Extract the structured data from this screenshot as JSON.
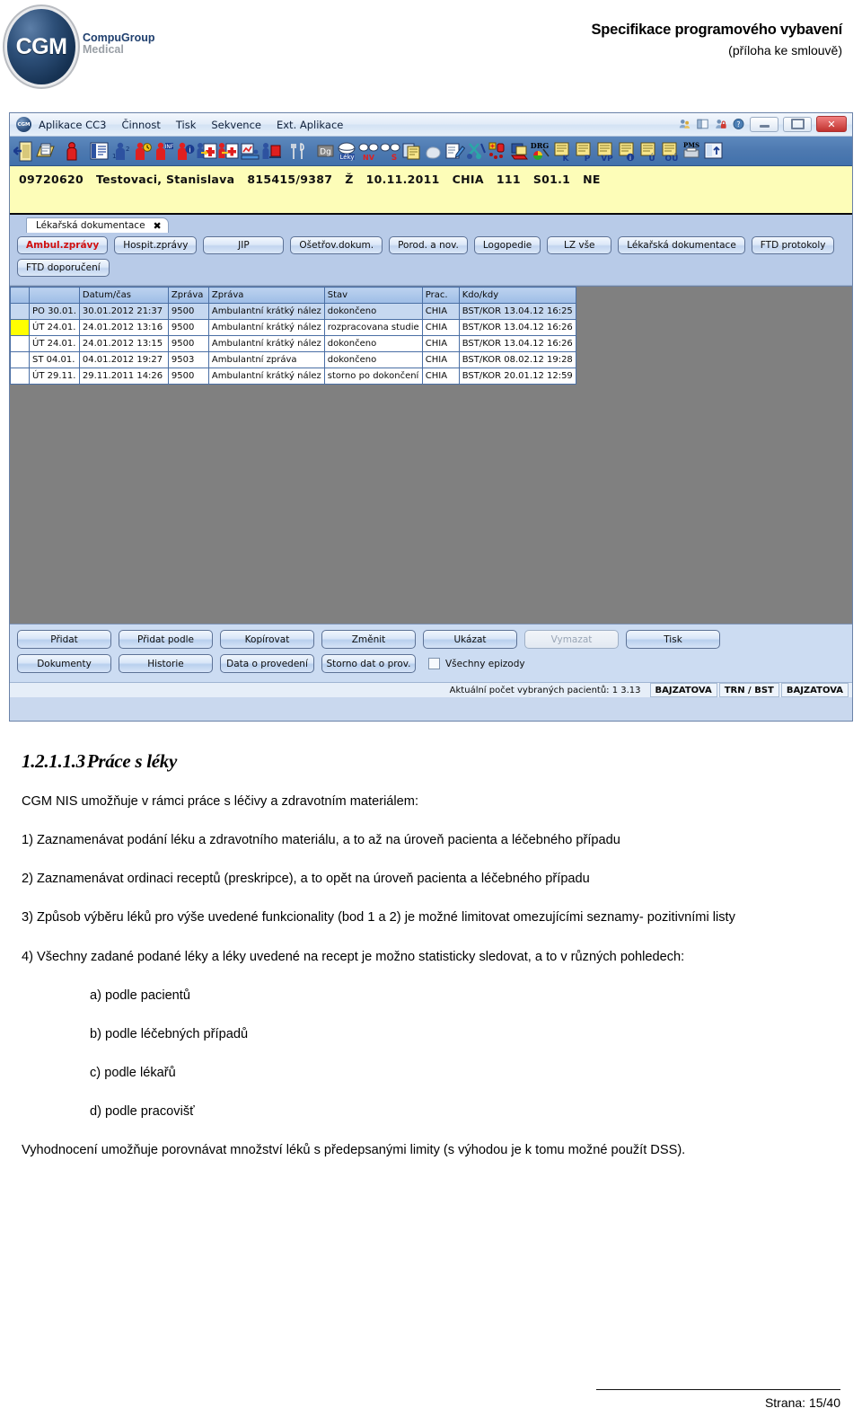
{
  "page_header": {
    "logo_mark": "CGM",
    "logo_line1": "CompuGroup",
    "logo_line2": "Medical",
    "title": "Specifikace programového vybavení",
    "subtitle": "(příloha ke smlouvě)"
  },
  "app": {
    "menu": {
      "badge": "CGM",
      "items": [
        "Aplikace CC3",
        "Činnost",
        "Tisk",
        "Sekvence",
        "Ext. Aplikace"
      ]
    },
    "window_controls": {
      "minimize": "–",
      "restore": "❐",
      "close": "✕"
    },
    "toolbar_icons": [
      "exit-door-icon",
      "folder-pages-icon",
      "patient-icon",
      "patient-list-icon",
      "patient-numbers-icon",
      "patient-clock-icon",
      "patient-inf-icon",
      "patient-info-icon",
      "patient-card-add-icon",
      "patient-card-transfer-icon",
      "patient-chart-icon",
      "patient-bed-icon",
      "patient-group-icon",
      "cutlery-icon",
      "dg-icon",
      "leky-pill-icon",
      "nv-glasses-icon",
      "glasses-s-icon",
      "calendar-notes-icon",
      "hand-icon",
      "prescription-pen-icon",
      "scissors-icon",
      "pills-scatter-icon",
      "folder-red-icon",
      "drg-icon",
      "report-k-icon",
      "report-p-icon",
      "report-vp-icon",
      "report-i-icon",
      "report-u-icon",
      "report-ou-icon",
      "pms-printer-icon",
      "export-icon"
    ],
    "patient_bar": [
      "09720620",
      "Testovaci, Stanislava",
      "815415/9387",
      "Ž",
      "10.11.2011",
      "CHIA",
      "111",
      "S01.1",
      "NE"
    ],
    "document_tab": {
      "label": "Lékařská dokumentace",
      "close": "✖"
    },
    "nav_buttons_row1": [
      {
        "label": "Ambul.zprávy",
        "active": true
      },
      {
        "label": "Hospit.zprávy",
        "active": false
      },
      {
        "label": "JIP",
        "active": false
      },
      {
        "label": "Ošetřov.dokum.",
        "active": false
      },
      {
        "label": "Porod. a nov.",
        "active": false
      },
      {
        "label": "Logopedie",
        "active": false
      },
      {
        "label": "LZ vše",
        "active": false
      },
      {
        "label": "Lékařská dokumentace",
        "active": false
      },
      {
        "label": "FTD protokoly",
        "active": false
      }
    ],
    "nav_buttons_row2": [
      {
        "label": "FTD doporučení",
        "active": false
      }
    ],
    "grid": {
      "columns": [
        "",
        "",
        "Datum/čas",
        "Zpráva",
        "Zpráva",
        "Stav",
        "Prac.",
        "Kdo/kdy"
      ],
      "rows": [
        {
          "flag": "",
          "selected": true,
          "day": "PO 30.01.",
          "datetime": "30.01.2012 21:37",
          "code": "9500",
          "msg": "Ambulantní krátký nález",
          "stav": "dokončeno",
          "prac": "CHIA",
          "kdo": "BST/KOR  13.04.12 16:25"
        },
        {
          "flag": "yellow",
          "selected": false,
          "day": "ÚT 24.01.",
          "datetime": "24.01.2012 13:16",
          "code": "9500",
          "msg": "Ambulantní krátký nález",
          "stav": "rozpracovana studie",
          "prac": "CHIA",
          "kdo": "BST/KOR  13.04.12 16:26"
        },
        {
          "flag": "",
          "selected": false,
          "day": "ÚT 24.01.",
          "datetime": "24.01.2012 13:15",
          "code": "9500",
          "msg": "Ambulantní krátký nález",
          "stav": "dokončeno",
          "prac": "CHIA",
          "kdo": "BST/KOR  13.04.12 16:26"
        },
        {
          "flag": "",
          "selected": false,
          "day": "ST 04.01.",
          "datetime": "04.01.2012 19:27",
          "code": "9503",
          "msg": "Ambulantní zpráva",
          "stav": "dokončeno",
          "prac": "CHIA",
          "kdo": "BST/KOR  08.02.12 19:28"
        },
        {
          "flag": "",
          "selected": false,
          "day": "ÚT 29.11.",
          "datetime": "29.11.2011 14:26",
          "code": "9500",
          "msg": "Ambulantní krátký nález",
          "stav": "storno po dokončení",
          "prac": "CHIA",
          "kdo": "BST/KOR  20.01.12 12:59"
        }
      ]
    },
    "command_buttons_row1": [
      {
        "label": "Přidat",
        "disabled": false
      },
      {
        "label": "Přidat podle",
        "disabled": false
      },
      {
        "label": "Kopírovat",
        "disabled": false
      },
      {
        "label": "Změnit",
        "disabled": false
      },
      {
        "label": "Ukázat",
        "disabled": false
      },
      {
        "label": "Vymazat",
        "disabled": true
      },
      {
        "label": "Tisk",
        "disabled": false
      }
    ],
    "command_buttons_row2": [
      {
        "label": "Dokumenty",
        "disabled": false
      },
      {
        "label": "Historie",
        "disabled": false
      },
      {
        "label": "Data o provedení",
        "disabled": false
      },
      {
        "label": "Storno dat o prov.",
        "disabled": false
      }
    ],
    "checkbox": {
      "label": "Všechny epizody",
      "checked": false
    },
    "status_bar": {
      "text": "Aktuální počet vybraných pacientů: 1   3.13",
      "cells": [
        "BAJZATOVA",
        "TRN / BST",
        "BAJZATOVA"
      ]
    }
  },
  "document": {
    "heading_number": "1.2.1.1.3",
    "heading_title": "Práce s léky",
    "paragraphs": [
      {
        "text": "CGM NIS umožňuje v rámci práce s léčivy a zdravotním materiálem:",
        "indent": false,
        "justify": false
      },
      {
        "text": "1) Zaznamenávat podání léku a zdravotního materiálu, a to až na úroveň pacienta a léčebného případu",
        "indent": false,
        "justify": true
      },
      {
        "text": "2) Zaznamenávat ordinaci receptů (preskripce), a to opět na úroveň pacienta a léčebného případu",
        "indent": false,
        "justify": false
      },
      {
        "text": "3) Způsob výběru léků pro výše uvedené funkcionality (bod 1 a 2) je možné limitovat omezujícími seznamy- pozitivními listy",
        "indent": false,
        "justify": true
      },
      {
        "text": "4) Všechny zadané podané léky a léky uvedené na recept je možno statisticky sledovat, a to v různých pohledech:",
        "indent": false,
        "justify": true
      },
      {
        "text": "a) podle pacientů",
        "indent": true,
        "justify": false
      },
      {
        "text": "b) podle léčebných případů",
        "indent": true,
        "justify": false
      },
      {
        "text": "c) podle lékařů",
        "indent": true,
        "justify": false
      },
      {
        "text": "d) podle pracovišť",
        "indent": true,
        "justify": false
      },
      {
        "text": " Vyhodnocení umožňuje porovnávat množství léků s předepsanými limity (s výhodou je k tomu možné použít DSS).",
        "indent": false,
        "justify": true
      }
    ],
    "footer_page": "Strana: 15/40"
  }
}
